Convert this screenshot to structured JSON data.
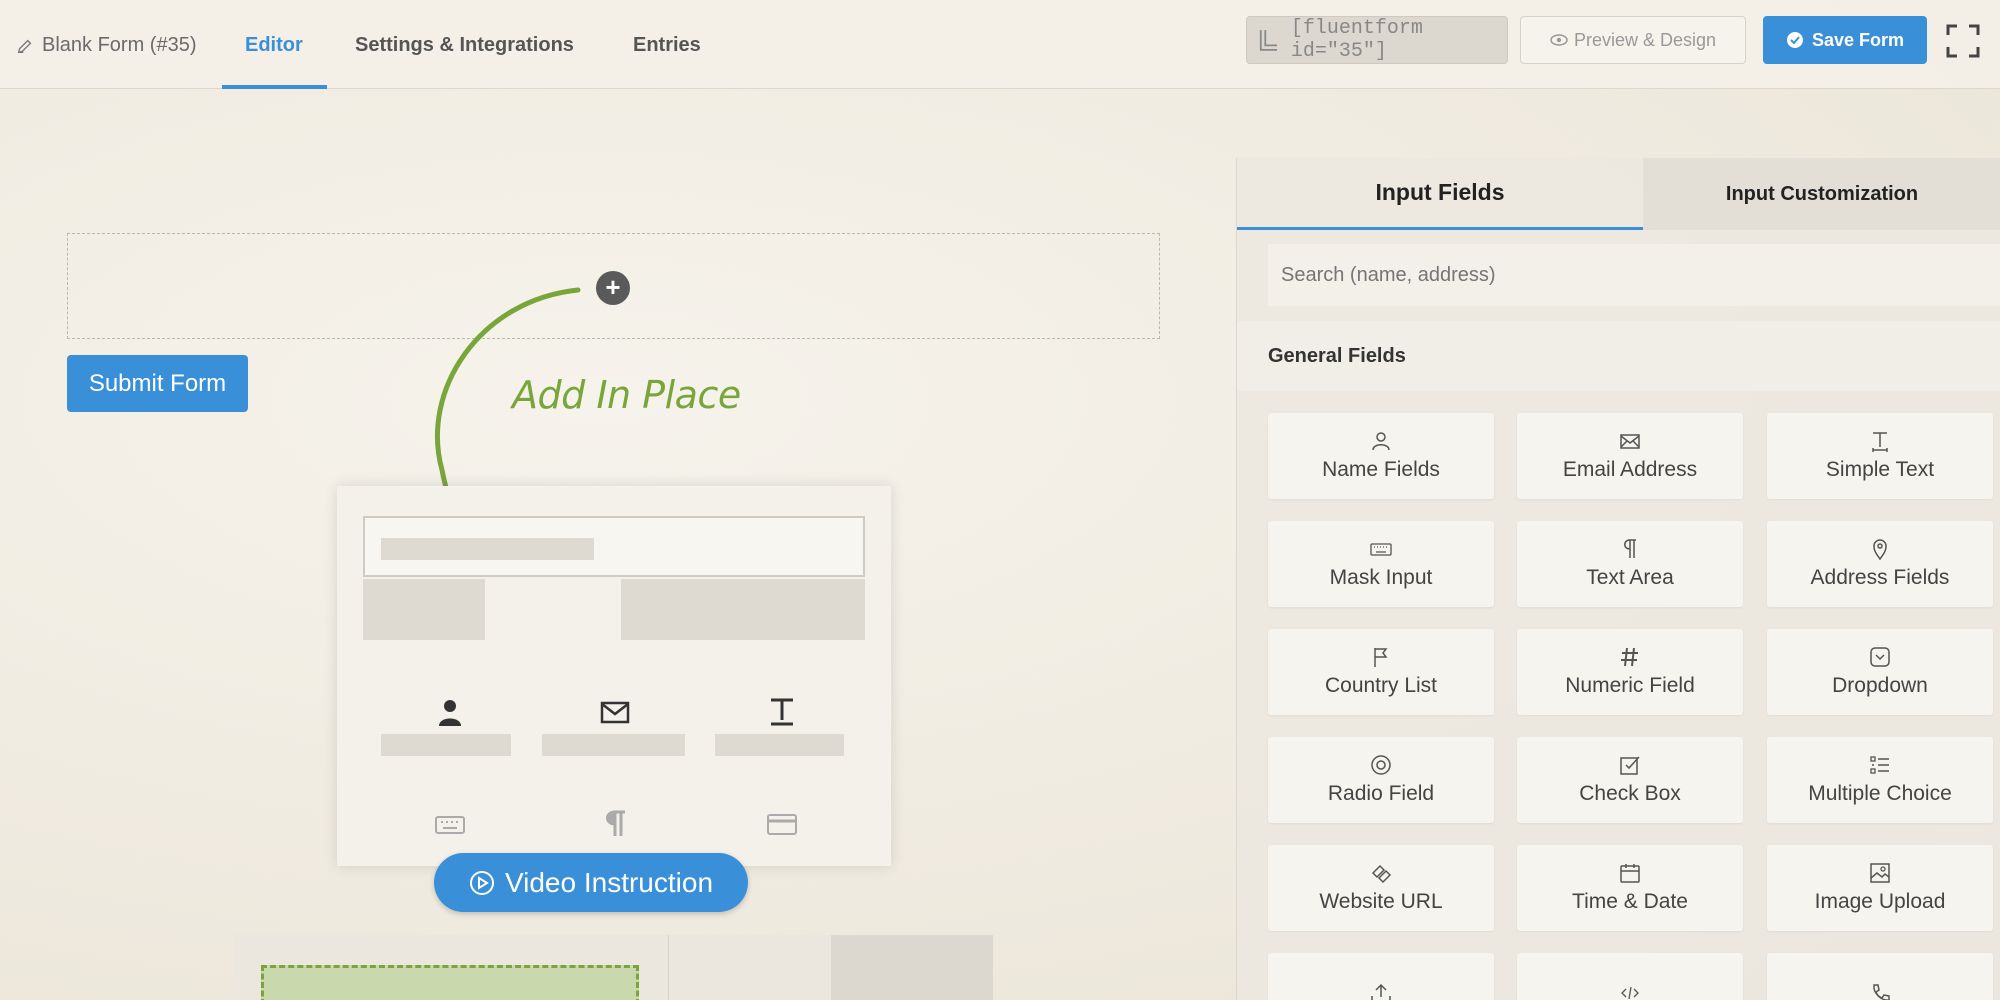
{
  "header": {
    "form_title": "Blank Form (#35)",
    "tabs": [
      "Editor",
      "Settings & Integrations",
      "Entries"
    ],
    "shortcode": "[fluentform id=\"35\"]",
    "preview_label": "Preview & Design",
    "save_label": "Save Form"
  },
  "canvas": {
    "submit_label": "Submit Form",
    "hint_text": "Add In Place",
    "video_label": "Video Instruction"
  },
  "panel": {
    "tabs": [
      "Input Fields",
      "Input Customization"
    ],
    "search_placeholder": "Search (name, address)",
    "section_title": "General Fields",
    "fields": [
      {
        "label": "Name Fields",
        "icon": "user-icon"
      },
      {
        "label": "Email Address",
        "icon": "envelope-icon"
      },
      {
        "label": "Simple Text",
        "icon": "text-icon"
      },
      {
        "label": "Mask Input",
        "icon": "keyboard-icon"
      },
      {
        "label": "Text Area",
        "icon": "paragraph-icon"
      },
      {
        "label": "Address Fields",
        "icon": "map-pin-icon"
      },
      {
        "label": "Country List",
        "icon": "flag-icon"
      },
      {
        "label": "Numeric Field",
        "icon": "hash-icon"
      },
      {
        "label": "Dropdown",
        "icon": "dropdown-icon"
      },
      {
        "label": "Radio Field",
        "icon": "radio-icon"
      },
      {
        "label": "Check Box",
        "icon": "checkbox-icon"
      },
      {
        "label": "Multiple Choice",
        "icon": "list-icon"
      },
      {
        "label": "Website URL",
        "icon": "link-icon"
      },
      {
        "label": "Time & Date",
        "icon": "calendar-icon"
      },
      {
        "label": "Image Upload",
        "icon": "image-icon"
      },
      {
        "label": "",
        "icon": "upload-icon"
      },
      {
        "label": "",
        "icon": "code-icon"
      },
      {
        "label": "",
        "icon": "phone-icon"
      }
    ]
  },
  "colors": {
    "accent": "#3a8fd9",
    "hint_green": "#79a63a"
  }
}
